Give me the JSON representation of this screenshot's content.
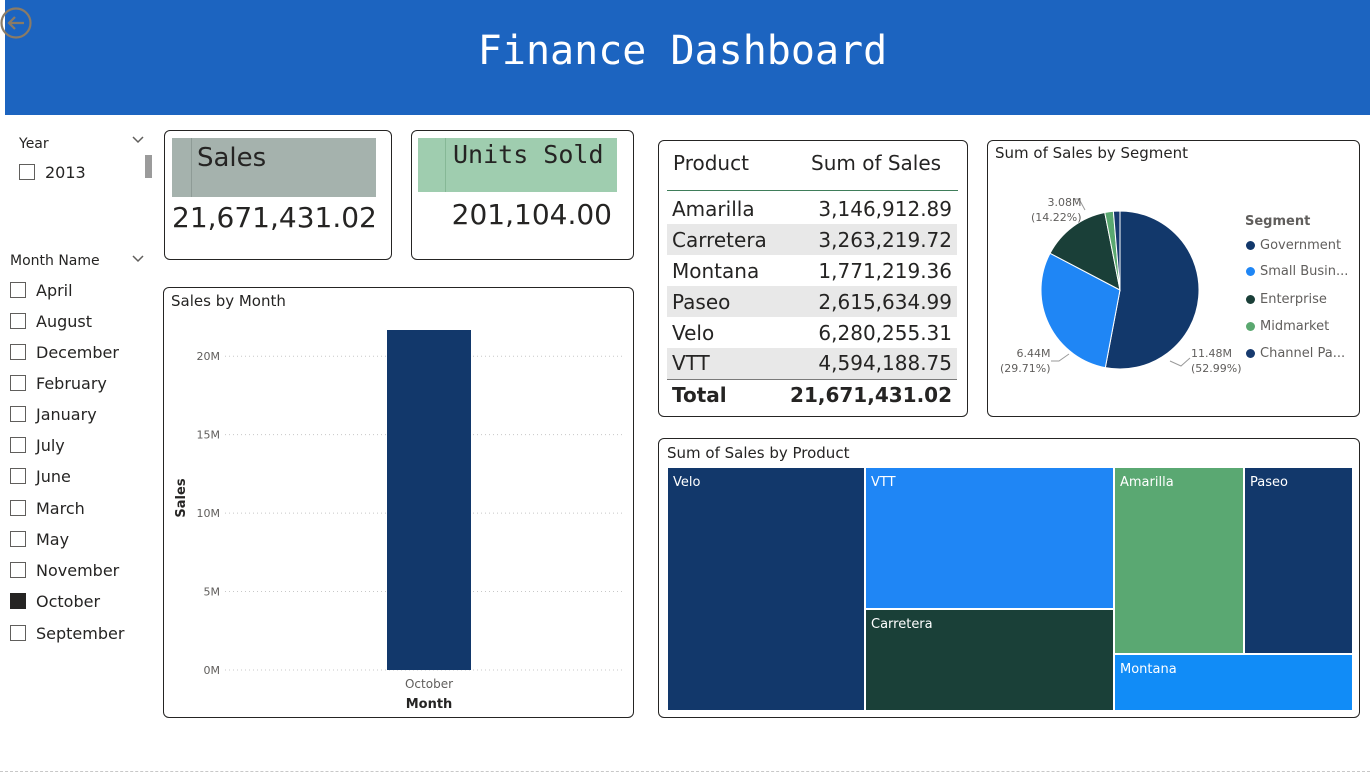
{
  "header": {
    "title": "Finance Dashboard"
  },
  "year_slicer": {
    "title": "Year",
    "options": [
      {
        "label": "2013",
        "checked": false
      }
    ]
  },
  "month_slicer": {
    "title": "Month Name",
    "options": [
      {
        "label": "April",
        "checked": false
      },
      {
        "label": "August",
        "checked": false
      },
      {
        "label": "December",
        "checked": false
      },
      {
        "label": "February",
        "checked": false
      },
      {
        "label": "January",
        "checked": false
      },
      {
        "label": "July",
        "checked": false
      },
      {
        "label": "June",
        "checked": false
      },
      {
        "label": "March",
        "checked": false
      },
      {
        "label": "May",
        "checked": false
      },
      {
        "label": "November",
        "checked": false
      },
      {
        "label": "October",
        "checked": true
      },
      {
        "label": "September",
        "checked": false
      }
    ]
  },
  "kpi_sales": {
    "title": "Sales",
    "value": "21,671,431.02",
    "color": "#a5b2ad"
  },
  "kpi_units": {
    "title": "Units Sold",
    "value": "201,104.00",
    "color": "#9fcdaf"
  },
  "sales_by_month": {
    "title": "Sales by Month"
  },
  "product_table": {
    "headers": [
      "Product",
      "Sum of Sales"
    ],
    "rows": [
      [
        "Amarilla",
        "3,146,912.89"
      ],
      [
        "Carretera",
        "3,263,219.72"
      ],
      [
        "Montana",
        "1,771,219.36"
      ],
      [
        "Paseo",
        "2,615,634.99"
      ],
      [
        "Velo",
        "6,280,255.31"
      ],
      [
        "VTT",
        "4,594,188.75"
      ]
    ],
    "total": [
      "Total",
      "21,671,431.02"
    ]
  },
  "segment_pie": {
    "title": "Sum of Sales by Segment",
    "legend_title": "Segment",
    "legend": [
      {
        "label": "Government",
        "color": "#12386b"
      },
      {
        "label": "Small Busin...",
        "color": "#1f86f5"
      },
      {
        "label": "Enterprise",
        "color": "#1a3f38"
      },
      {
        "label": "Midmarket",
        "color": "#5aa870"
      },
      {
        "label": "Channel Pa...",
        "color": "#173a6e"
      }
    ],
    "labels": {
      "top": [
        "3.08M",
        "(14.22%)"
      ],
      "left": [
        "6.44M",
        "(29.71%)"
      ],
      "right": [
        "11.48M",
        "(52.99%)"
      ]
    }
  },
  "treemap": {
    "title": "Sum of Sales by Product",
    "tiles": [
      {
        "label": "Velo",
        "color": "#12386b"
      },
      {
        "label": "VTT",
        "color": "#1f86f5"
      },
      {
        "label": "Carretera",
        "color": "#1a4038"
      },
      {
        "label": "Amarilla",
        "color": "#5aa872"
      },
      {
        "label": "Paseo",
        "color": "#12386b"
      },
      {
        "label": "Montana",
        "color": "#118cf7"
      }
    ]
  },
  "chart_data": [
    {
      "type": "bar",
      "title": "Sales by Month",
      "categories": [
        "October"
      ],
      "values": [
        21671431.02
      ],
      "xlabel": "Month",
      "ylabel": "Sales",
      "ylim": [
        0,
        21671431.02
      ],
      "yticks": [
        "0M",
        "5M",
        "10M",
        "15M",
        "20M"
      ],
      "ytick_values": [
        0,
        5000000,
        10000000,
        15000000,
        20000000
      ],
      "grid": true,
      "bar_color": "#12386b"
    },
    {
      "type": "pie",
      "title": "Sum of Sales by Segment",
      "categories": [
        "Government",
        "Small Business",
        "Enterprise",
        "Midmarket",
        "Channel Partners"
      ],
      "values": [
        11.48,
        6.44,
        3.08,
        0.38,
        0.29
      ],
      "colors": [
        "#12386b",
        "#1f86f5",
        "#1a3f38",
        "#5aa870",
        "#173a6e"
      ]
    }
  ]
}
